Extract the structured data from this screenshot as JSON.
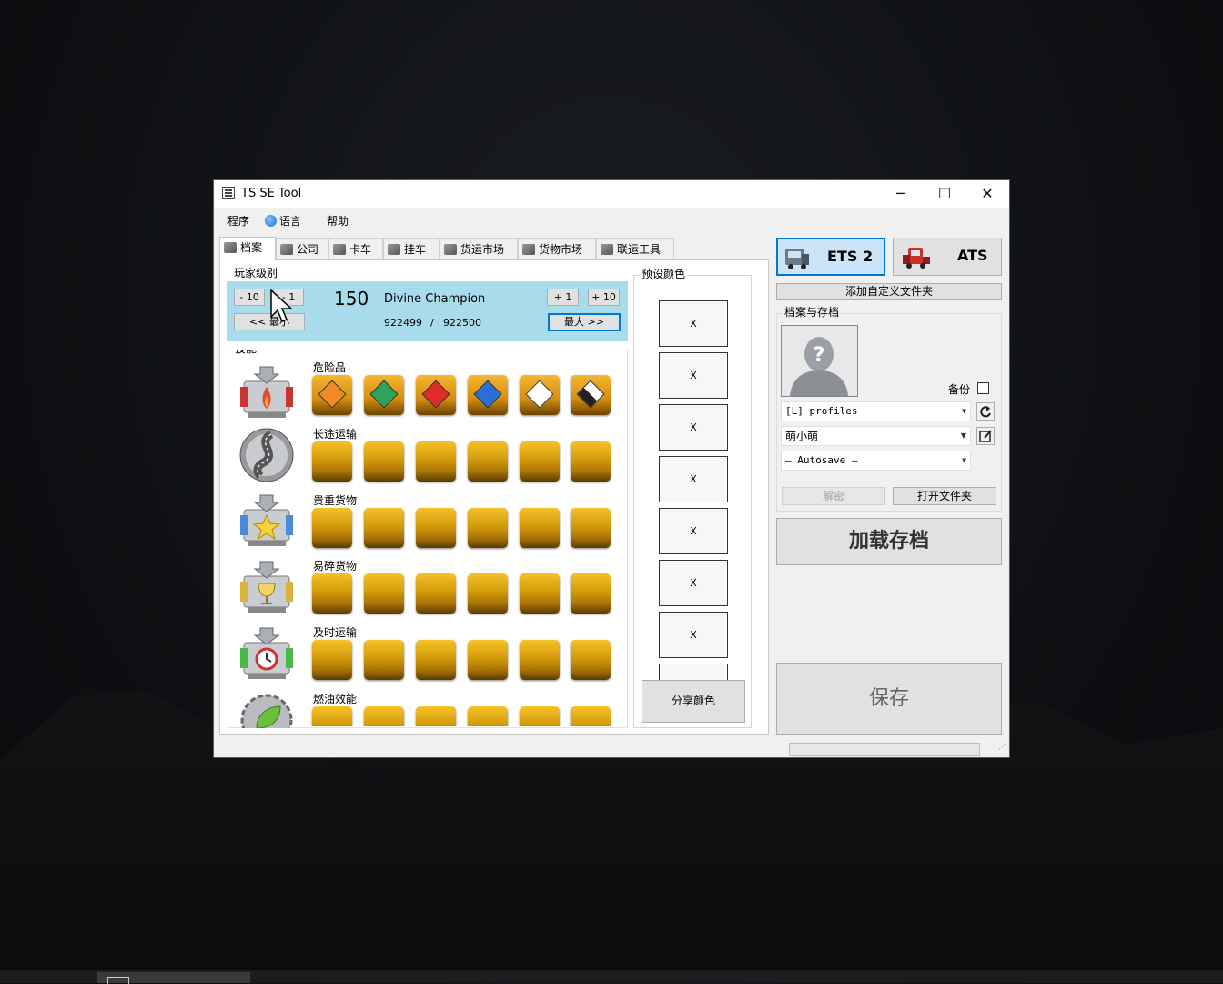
{
  "window": {
    "title": "TS SE Tool",
    "minimize": "─",
    "maximize": "☐",
    "close": "✕"
  },
  "menu": [
    "程序",
    "语言",
    "帮助"
  ],
  "tabs": [
    "档案",
    "公司",
    "卡车",
    "挂车",
    "货运市场",
    "货物市场",
    "联运工具"
  ],
  "player_level": {
    "group_label": "玩家级别",
    "minus10": "- 10",
    "minus1": "- 1",
    "min_btn": "<< 最小",
    "plus1": "+ 1",
    "plus10": "+ 10",
    "max_btn": "最大 >>",
    "level": "150",
    "rank": "Divine Champion",
    "xp_current": "922499",
    "xp_separator": "/",
    "xp_max": "922500"
  },
  "skills": {
    "group_label": "技能",
    "rows": [
      {
        "name": "危险品",
        "icon": "hazard-skill-icon",
        "filled": 6
      },
      {
        "name": "长途运输",
        "icon": "long-distance-skill-icon",
        "filled": 6
      },
      {
        "name": "贵重货物",
        "icon": "high-value-skill-icon",
        "filled": 6
      },
      {
        "name": "易碎货物",
        "icon": "fragile-skill-icon",
        "filled": 6
      },
      {
        "name": "及时运输",
        "icon": "just-in-time-skill-icon",
        "filled": 6
      },
      {
        "name": "燃油效能",
        "icon": "eco-driving-skill-icon",
        "filled": 6
      }
    ]
  },
  "preset_colors": {
    "group_label": "预设颜色",
    "slots": [
      "X",
      "X",
      "X",
      "X",
      "X",
      "X",
      "X"
    ],
    "share_btn": "分享颜色"
  },
  "right": {
    "ets2": "ETS 2",
    "ats": "ATS",
    "add_folder": "添加自定义文件夹",
    "profiles_group": "档案与存档",
    "backup": "备份",
    "profile_source": "[L] profiles",
    "profile_name": "萌小萌",
    "save_slot": "— Autosave —",
    "decrypt": "解密",
    "open_folder": "打开文件夹",
    "load_save": "加载存档",
    "save": "保存"
  },
  "colors": {
    "accent": "#0078d7",
    "level_bg": "#a8dcec",
    "gold": "#d49a0d"
  }
}
